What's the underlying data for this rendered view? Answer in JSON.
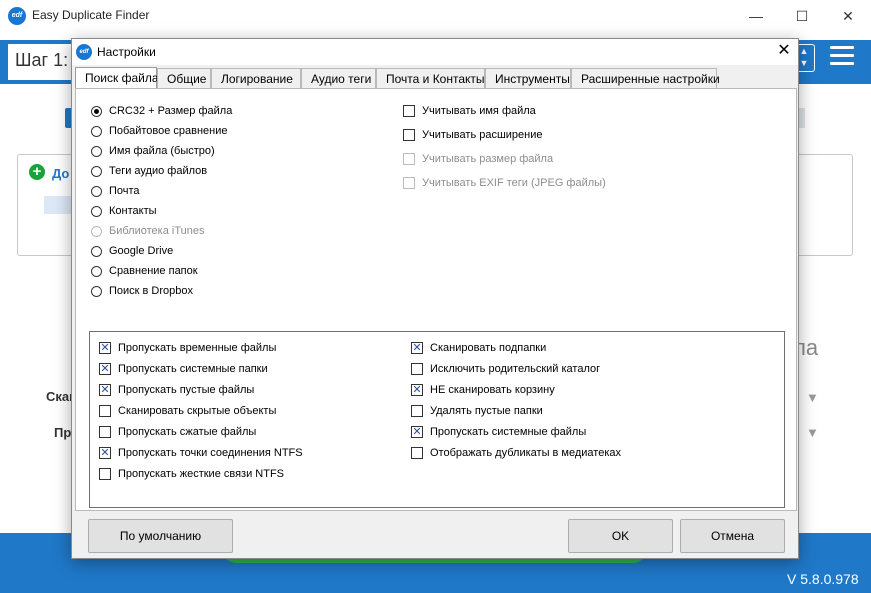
{
  "main_window": {
    "title": "Easy Duplicate Finder",
    "logo_text": "edf",
    "step_label": "Шаг 1:",
    "add_label": "До",
    "bg_right_label": "па",
    "scan_label_1": "Скан",
    "scan_label_2": "Пр",
    "version": "V 5.8.0.978",
    "window_buttons": {
      "minimize": "—",
      "maximize": "☐",
      "close": "✕"
    }
  },
  "dialog": {
    "title": "Настройки",
    "logo_text": "edf",
    "close_glyph": "✕",
    "tabs": [
      {
        "label": "Поиск файла",
        "active": true
      },
      {
        "label": "Общие",
        "active": false
      },
      {
        "label": "Логирование",
        "active": false
      },
      {
        "label": "Аудио теги",
        "active": false
      },
      {
        "label": "Почта и Контакты",
        "active": false
      },
      {
        "label": "Инструменты",
        "active": false
      },
      {
        "label": "Расширенные настройки",
        "active": false
      }
    ],
    "search_modes": [
      {
        "label": "CRC32 + Размер файла",
        "selected": true,
        "enabled": true
      },
      {
        "label": "Побайтовое сравнение",
        "selected": false,
        "enabled": true
      },
      {
        "label": "Имя файла (быстро)",
        "selected": false,
        "enabled": true
      },
      {
        "label": "Теги аудио файлов",
        "selected": false,
        "enabled": true
      },
      {
        "label": "Почта",
        "selected": false,
        "enabled": true
      },
      {
        "label": "Контакты",
        "selected": false,
        "enabled": true
      },
      {
        "label": "Библиотека iTunes",
        "selected": false,
        "enabled": false
      },
      {
        "label": "Google Drive",
        "selected": false,
        "enabled": true
      },
      {
        "label": "Сравнение папок",
        "selected": false,
        "enabled": true
      },
      {
        "label": "Поиск в Dropbox",
        "selected": false,
        "enabled": true
      }
    ],
    "match_options": [
      {
        "label": "Учитывать имя файла",
        "checked": false,
        "enabled": true
      },
      {
        "label": "Учитывать расширение",
        "checked": false,
        "enabled": true
      },
      {
        "label": "Учитывать размер файла",
        "checked": false,
        "enabled": false
      },
      {
        "label": "Учитывать EXIF теги (JPEG файлы)",
        "checked": false,
        "enabled": false
      }
    ],
    "scan_options_left": [
      {
        "label": "Пропускать временные файлы",
        "checked": true
      },
      {
        "label": "Пропускать системные папки",
        "checked": true
      },
      {
        "label": "Пропускать пустые файлы",
        "checked": true
      },
      {
        "label": "Сканировать скрытые объекты",
        "checked": false
      },
      {
        "label": "Пропускать сжатые файлы",
        "checked": false
      },
      {
        "label": "Пропускать точки соединения NTFS",
        "checked": true
      },
      {
        "label": "Пропускать жесткие связи NTFS",
        "checked": false
      }
    ],
    "scan_options_right": [
      {
        "label": "Сканировать подпапки",
        "checked": true
      },
      {
        "label": "Исключить родительский каталог",
        "checked": false
      },
      {
        "label": "НЕ сканировать корзину",
        "checked": true
      },
      {
        "label": "Удалять пустые папки",
        "checked": false
      },
      {
        "label": "Пропускать системные файлы",
        "checked": true
      },
      {
        "label": "Отображать дубликаты в медиатеках",
        "checked": false
      }
    ],
    "buttons": {
      "defaults": "По умолчанию",
      "ok": "OK",
      "cancel": "Отмена"
    }
  },
  "colors": {
    "accent": "#1f78c8",
    "green": "#2eb84b",
    "check": "#2a4f9a"
  }
}
